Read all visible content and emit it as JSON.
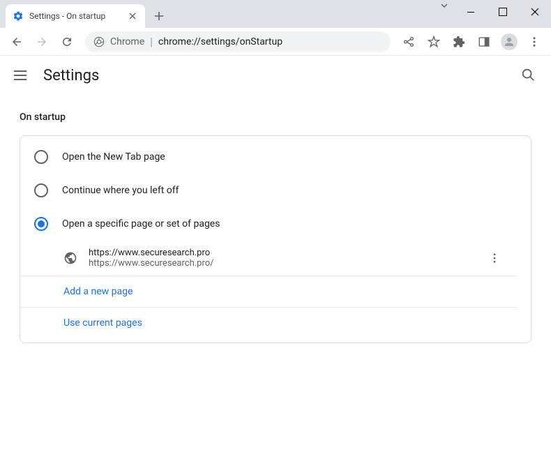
{
  "window": {
    "tab_title": "Settings - On startup"
  },
  "address": {
    "prefix": "Chrome",
    "url": "chrome://settings/onStartup"
  },
  "header": {
    "title": "Settings"
  },
  "section": {
    "title": "On startup",
    "options": [
      {
        "label": "Open the New Tab page",
        "selected": false
      },
      {
        "label": "Continue where you left off",
        "selected": false
      },
      {
        "label": "Open a specific page or set of pages",
        "selected": true
      }
    ],
    "page_entry": {
      "title": "https://www.securesearch.pro",
      "url": "https://www.securesearch.pro/"
    },
    "add_page_label": "Add a new page",
    "use_current_label": "Use current pages"
  }
}
